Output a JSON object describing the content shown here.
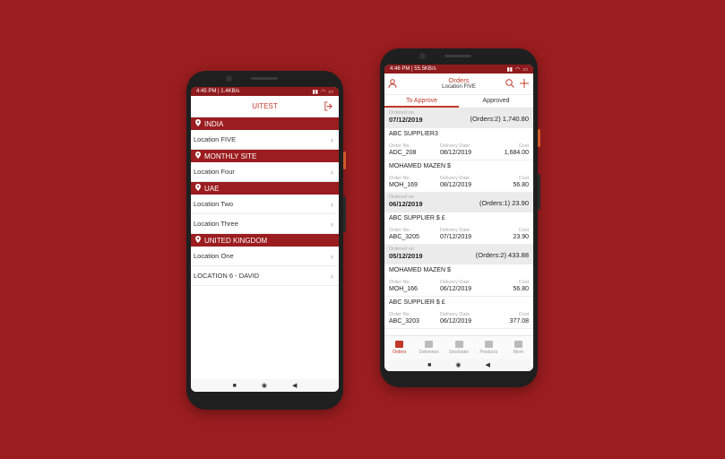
{
  "phone1": {
    "status": {
      "time": "4:45 PM | 1.4KB/s"
    },
    "title": "UITEST",
    "groups": [
      {
        "name": "INDIA",
        "locations": [
          "Location FIVE"
        ]
      },
      {
        "name": "MONTHLY SITE",
        "locations": [
          "Location Four"
        ]
      },
      {
        "name": "UAE",
        "locations": [
          "Location Two",
          "Location Three"
        ]
      },
      {
        "name": "UNITED KINGDOM",
        "locations": [
          "Location One",
          "LOCATION 6 - DAVID"
        ]
      }
    ]
  },
  "phone2": {
    "status": {
      "time": "4:46 PM | 55.5KB/s"
    },
    "title": "Orders",
    "subtitle": "Location FIVE",
    "tabs": {
      "active": "To Approve",
      "other": "Approved"
    },
    "labels": {
      "ordered_on": "Ordered on",
      "order_no": "Order No.",
      "delivery_date": "Delivery Date",
      "cost": "Cost"
    },
    "groups": [
      {
        "date": "07/12/2019",
        "total": "(Orders:2) 1,740.80",
        "orders": [
          {
            "supplier": "ABC SUPPLIER3",
            "order_no": "ADC_208",
            "delivery": "08/12/2019",
            "cost": "1,684.00"
          },
          {
            "supplier": "MOHAMED MAZEN $",
            "order_no": "MOH_169",
            "delivery": "08/12/2019",
            "cost": "56.80"
          }
        ]
      },
      {
        "date": "06/12/2019",
        "total": "(Orders:1) 23.90",
        "orders": [
          {
            "supplier": "ABC SUPPLIER $ £",
            "order_no": "ABC_3205",
            "delivery": "07/12/2019",
            "cost": "23.90"
          }
        ]
      },
      {
        "date": "05/12/2019",
        "total": "(Orders:2) 433.88",
        "orders": [
          {
            "supplier": "MOHAMED MAZEN $",
            "order_no": "MOH_166",
            "delivery": "06/12/2019",
            "cost": "56.80"
          },
          {
            "supplier": "ABC SUPPLIER $ £",
            "order_no": "ABC_3203",
            "delivery": "06/12/2019",
            "cost": "377.08"
          }
        ]
      }
    ],
    "bottom_nav": [
      "Orders",
      "Deliveries",
      "Stocktake",
      "Products",
      "More"
    ]
  },
  "colors": {
    "brand": "#9b1d1f",
    "accent": "#c0392b"
  }
}
